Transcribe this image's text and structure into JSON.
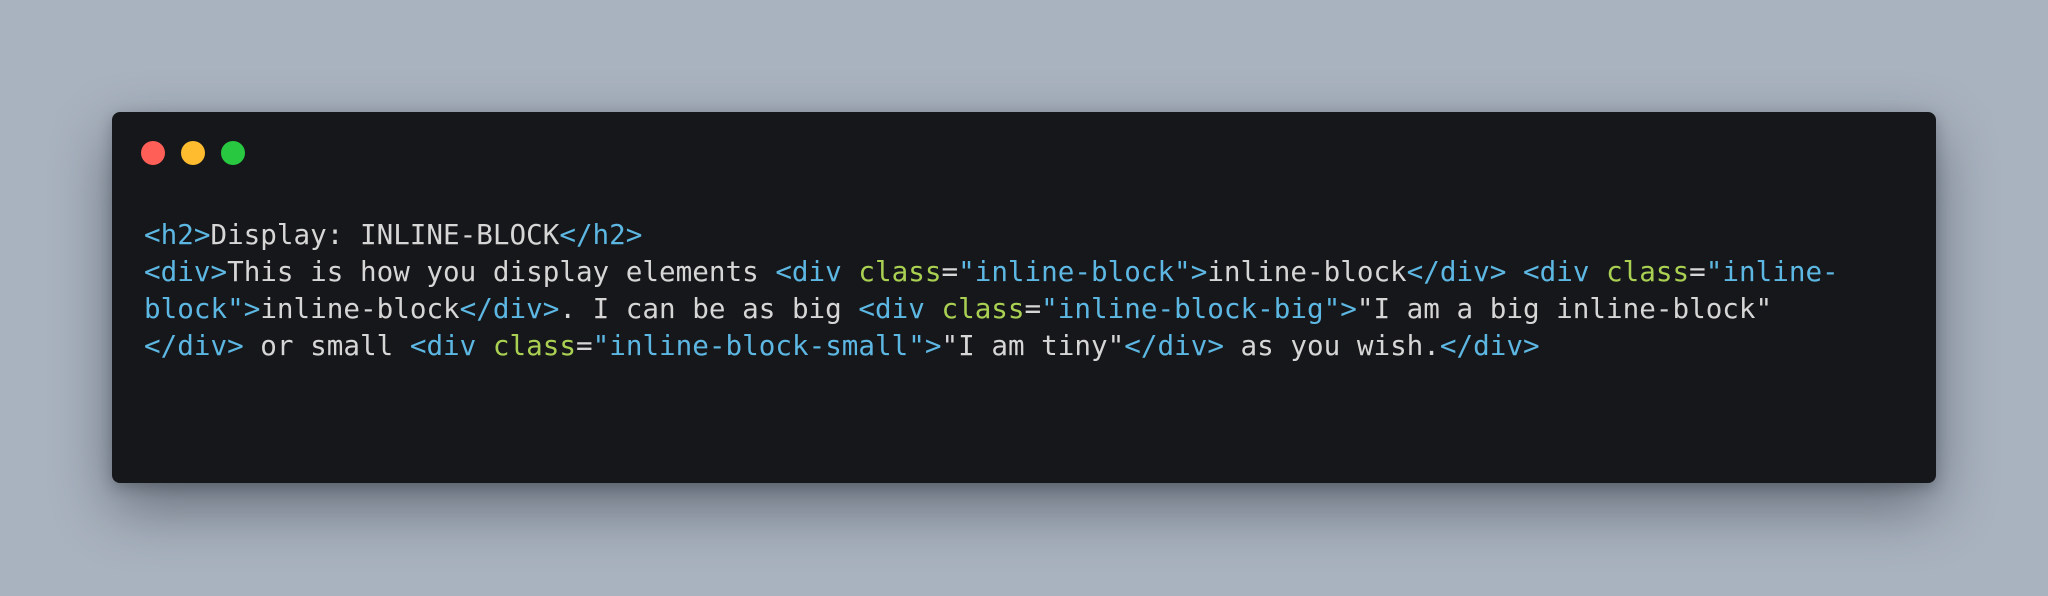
{
  "window": {
    "controls": {
      "close_color": "#ff5f57",
      "minimize_color": "#febc2e",
      "zoom_color": "#28c840"
    }
  },
  "theme": {
    "background": "#a9b3bf",
    "editor_background": "#16171a",
    "tag_color": "#5db7e3",
    "attr_color": "#a9d052",
    "string_color": "#5db7e3",
    "text_color": "#d6d6d6"
  },
  "code": {
    "lines": [
      [
        {
          "t": "tag",
          "v": "<h2>"
        },
        {
          "t": "text",
          "v": "Display: INLINE-BLOCK"
        },
        {
          "t": "tag",
          "v": "</h2>"
        }
      ],
      [
        {
          "t": "tag",
          "v": "<div>"
        },
        {
          "t": "text",
          "v": "This is how you display elements "
        },
        {
          "t": "tag",
          "v": "<div "
        },
        {
          "t": "attr",
          "v": "class"
        },
        {
          "t": "punct",
          "v": "="
        },
        {
          "t": "str",
          "v": "\"inline-block\""
        },
        {
          "t": "tag",
          "v": ">"
        },
        {
          "t": "text",
          "v": "inline-block"
        },
        {
          "t": "tag",
          "v": "</div>"
        },
        {
          "t": "text",
          "v": " "
        },
        {
          "t": "tag",
          "v": "<div "
        },
        {
          "t": "attr",
          "v": "class"
        },
        {
          "t": "punct",
          "v": "="
        },
        {
          "t": "str",
          "v": "\"inline-"
        }
      ],
      [
        {
          "t": "str",
          "v": "block\""
        },
        {
          "t": "tag",
          "v": ">"
        },
        {
          "t": "text",
          "v": "inline-block"
        },
        {
          "t": "tag",
          "v": "</div>"
        },
        {
          "t": "text",
          "v": ". I can be as big "
        },
        {
          "t": "tag",
          "v": "<div "
        },
        {
          "t": "attr",
          "v": "class"
        },
        {
          "t": "punct",
          "v": "="
        },
        {
          "t": "str",
          "v": "\"inline-block-big\""
        },
        {
          "t": "tag",
          "v": ">"
        },
        {
          "t": "text",
          "v": "\"I am a big inline-block\""
        }
      ],
      [
        {
          "t": "tag",
          "v": "</div>"
        },
        {
          "t": "text",
          "v": " or small "
        },
        {
          "t": "tag",
          "v": "<div "
        },
        {
          "t": "attr",
          "v": "class"
        },
        {
          "t": "punct",
          "v": "="
        },
        {
          "t": "str",
          "v": "\"inline-block-small\""
        },
        {
          "t": "tag",
          "v": ">"
        },
        {
          "t": "text",
          "v": "\"I am tiny\""
        },
        {
          "t": "tag",
          "v": "</div>"
        },
        {
          "t": "text",
          "v": " as you wish."
        },
        {
          "t": "tag",
          "v": "</div>"
        }
      ]
    ]
  }
}
